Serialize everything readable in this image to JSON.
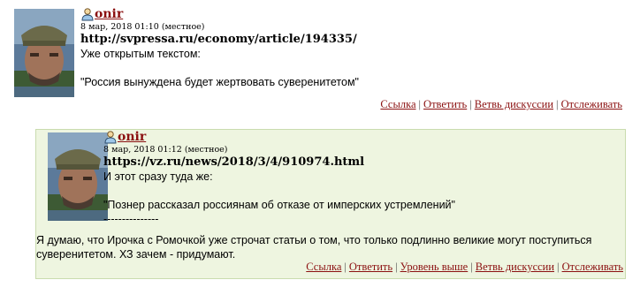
{
  "comments": [
    {
      "author": "onir",
      "date": "8 мар, 2018 01:10 (местное)",
      "link": "http://svpressa.ru/economy/article/194335/",
      "text_lines": [
        "Уже открытым текстом:",
        "",
        "\"Россия вынуждена будет жертвовать суверенитетом\""
      ],
      "actions": [
        "Ссылка",
        "Ответить",
        "Ветвь дискуссии",
        "Отслеживать"
      ]
    },
    {
      "author": "onir",
      "date": "8 мар, 2018 01:12 (местное)",
      "link": "https://vz.ru/news/2018/3/4/910974.html",
      "text_lines": [
        "И этот сразу туда же:",
        "",
        "\"Познер рассказал россиянам об отказе от имперских устремлений\"",
        "---------------"
      ],
      "full_text": "Я думаю, что Ирочка с Ромочкой уже строчат статьи о том, что только подлинно великие могут поступиться суверенитетом. ХЗ зачем - придумают.",
      "actions": [
        "Ссылка",
        "Ответить",
        "Уровень выше",
        "Ветвь дискуссии",
        "Отслеживать"
      ]
    }
  ],
  "colors": {
    "link": "#8b1010",
    "reply_bg": "#eef5e0",
    "reply_border": "#c9dcae"
  }
}
